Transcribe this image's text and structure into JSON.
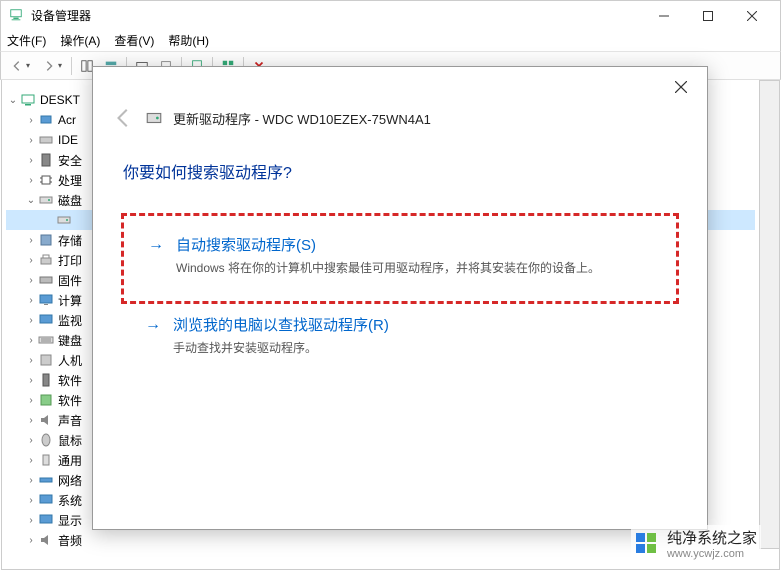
{
  "titlebar": {
    "title": "设备管理器"
  },
  "menu": {
    "file": "文件(F)",
    "action": "操作(A)",
    "view": "查看(V)",
    "help": "帮助(H)"
  },
  "tree": {
    "root": "DESKT",
    "items": [
      {
        "label": "Acr"
      },
      {
        "label": "IDE"
      },
      {
        "label": "安全"
      },
      {
        "label": "处理"
      },
      {
        "label": "磁盘",
        "expanded": true,
        "child": ""
      },
      {
        "label": "存储"
      },
      {
        "label": "打印"
      },
      {
        "label": "固件"
      },
      {
        "label": "计算"
      },
      {
        "label": "监视"
      },
      {
        "label": "键盘"
      },
      {
        "label": "人机"
      },
      {
        "label": "软件"
      },
      {
        "label": "软件"
      },
      {
        "label": "声音"
      },
      {
        "label": "鼠标"
      },
      {
        "label": "通用"
      },
      {
        "label": "网络"
      },
      {
        "label": "系统"
      },
      {
        "label": "显示"
      },
      {
        "label": "音频"
      }
    ]
  },
  "dialog": {
    "title": "更新驱动程序 - WDC WD10EZEX-75WN4A1",
    "question": "你要如何搜索驱动程序?",
    "option1": {
      "title": "自动搜索驱动程序(S)",
      "desc": "Windows 将在你的计算机中搜索最佳可用驱动程序，并将其安装在你的设备上。"
    },
    "option2": {
      "title": "浏览我的电脑以查找驱动程序(R)",
      "desc": "手动查找并安装驱动程序。"
    }
  },
  "watermark": {
    "text": "纯净系统之家",
    "url": "www.ycwjz.com"
  }
}
